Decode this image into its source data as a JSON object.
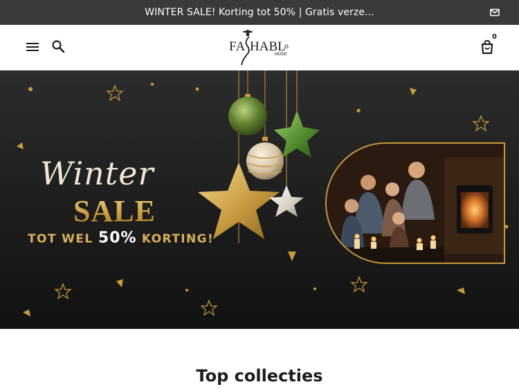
{
  "announcement": {
    "text": "WINTER SALE! Korting tot 50% | Gratis verze...",
    "icon": "mail-icon"
  },
  "header": {
    "menu_icon": "hamburger-menu-icon",
    "search_icon": "search-icon",
    "logo_text": "FASHABLO",
    "logo_subtext": "MODE",
    "cart_icon": "shopping-bag-icon",
    "cart_count": "0"
  },
  "hero": {
    "script_text": "Winter",
    "sale_text": "SALE",
    "subline_pre": "TOT WEL ",
    "subline_pct": "50%",
    "subline_post": " KORTING!",
    "colors": {
      "gold": "#d7b05c",
      "background": "#1d1d1d"
    }
  },
  "collections": {
    "title": "Top collecties"
  }
}
